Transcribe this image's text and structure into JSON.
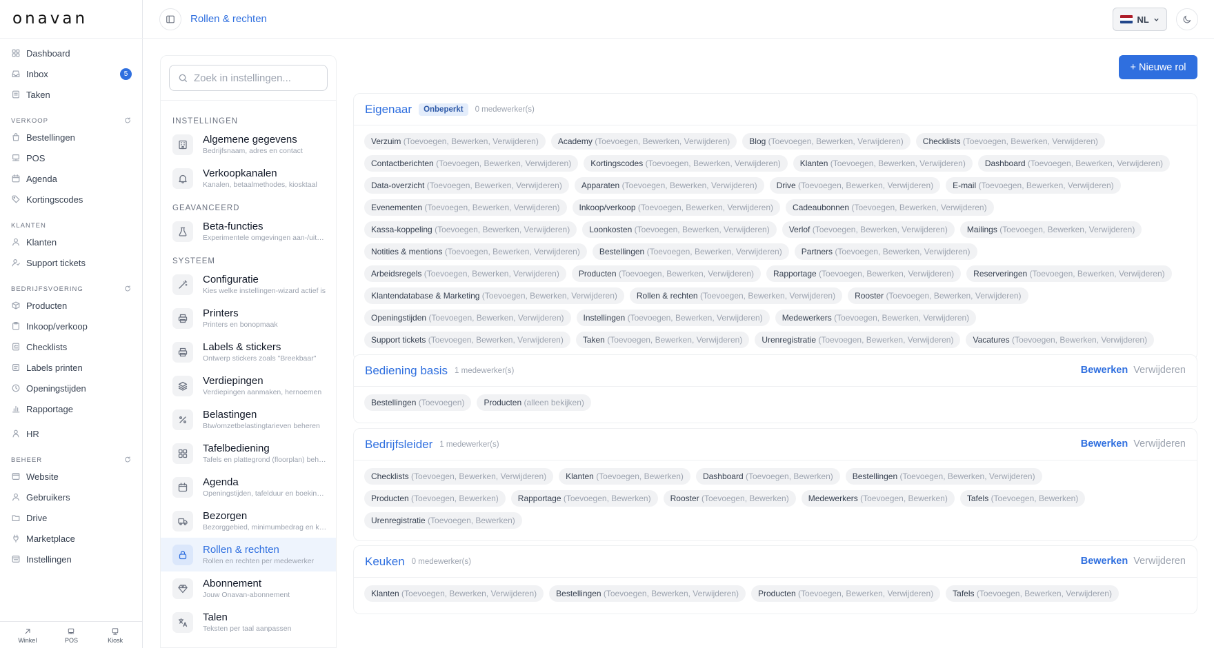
{
  "brand": {
    "logo": "onavan"
  },
  "sidebar": {
    "items_top": [
      {
        "label": "Dashboard",
        "icon": "grid-icon"
      },
      {
        "label": "Inbox",
        "icon": "inbox-icon",
        "badge": "5"
      },
      {
        "label": "Taken",
        "icon": "task-icon"
      }
    ],
    "sections": [
      {
        "title": "VERKOOP",
        "items": [
          {
            "label": "Bestellingen",
            "icon": "shopping-bag-icon"
          },
          {
            "label": "POS",
            "icon": "pos-icon"
          },
          {
            "label": "Agenda",
            "icon": "calendar-icon"
          },
          {
            "label": "Kortingscodes",
            "icon": "tag-icon"
          }
        ]
      },
      {
        "title": "KLANTEN",
        "items": [
          {
            "label": "Klanten",
            "icon": "user-icon"
          },
          {
            "label": "Support tickets",
            "icon": "support-icon"
          }
        ]
      },
      {
        "title": "BEDRIJFSVOERING",
        "items": [
          {
            "label": "Producten",
            "icon": "box-icon"
          },
          {
            "label": "Inkoop/verkoop",
            "icon": "clipboard-icon"
          },
          {
            "label": "Checklists",
            "icon": "checklist-icon"
          },
          {
            "label": "Labels printen",
            "icon": "label-icon"
          },
          {
            "label": "Openingstijden",
            "icon": "clock-icon"
          },
          {
            "label": "Rapportage",
            "icon": "bar-chart-icon"
          }
        ]
      }
    ],
    "hr": {
      "label": "HR",
      "icon": "person-icon"
    },
    "beheer": {
      "title": "BEHEER",
      "items": [
        {
          "label": "Website",
          "icon": "window-icon"
        },
        {
          "label": "Gebruikers",
          "icon": "user-icon"
        },
        {
          "label": "Drive",
          "icon": "folder-icon"
        },
        {
          "label": "Marketplace",
          "icon": "plug-icon"
        },
        {
          "label": "Instellingen",
          "icon": "settings-window-icon"
        }
      ]
    },
    "bottom": [
      {
        "label": "Winkel",
        "icon": "arrow-icon"
      },
      {
        "label": "POS",
        "icon": "pos-icon"
      },
      {
        "label": "Kiosk",
        "icon": "kiosk-icon"
      }
    ]
  },
  "topbar": {
    "title": "Rollen & rechten",
    "language": "NL"
  },
  "settings": {
    "search_placeholder": "Zoek in instellingen...",
    "sections": [
      {
        "title": "INSTELLINGEN",
        "items": [
          {
            "title": "Algemene gegevens",
            "subtitle": "Bedrijfsnaam, adres en contact",
            "icon": "building-icon"
          },
          {
            "title": "Verkoopkanalen",
            "subtitle": "Kanalen, betaalmethodes, kiosktaal",
            "icon": "bell-icon"
          }
        ]
      },
      {
        "title": "GEAVANCEERD",
        "items": [
          {
            "title": "Beta-functies",
            "subtitle": "Experimentele omgevingen aan-/uitzetten",
            "icon": "flask-icon"
          }
        ]
      },
      {
        "title": "SYSTEEM",
        "items": [
          {
            "title": "Configuratie",
            "subtitle": "Kies welke instellingen-wizard actief is",
            "icon": "wand-icon"
          },
          {
            "title": "Printers",
            "subtitle": "Printers en bonopmaak",
            "icon": "printer-icon"
          },
          {
            "title": "Labels & stickers",
            "subtitle": "Ontwerp stickers zoals \"Breekbaar\"",
            "icon": "printer-icon"
          },
          {
            "title": "Verdiepingen",
            "subtitle": "Verdiepingen aanmaken, hernoemen",
            "icon": "layers-icon"
          },
          {
            "title": "Belastingen",
            "subtitle": "Btw/omzetbelastingtarieven beheren",
            "icon": "percent-icon"
          },
          {
            "title": "Tafelbediening",
            "subtitle": "Tafels en plattegrond (floorplan) beheren",
            "icon": "grid-icon"
          },
          {
            "title": "Agenda",
            "subtitle": "Openingstijden, tafelduur en boekingen",
            "icon": "calendar-icon"
          },
          {
            "title": "Bezorgen",
            "subtitle": "Bezorggebied, minimumbedrag en kosten",
            "icon": "truck-icon"
          },
          {
            "title": "Rollen & rechten",
            "subtitle": "Rollen en rechten per medewerker",
            "icon": "lock-icon",
            "active": true
          },
          {
            "title": "Abonnement",
            "subtitle": "Jouw Onavan-abonnement",
            "icon": "diamond-icon"
          },
          {
            "title": "Talen",
            "subtitle": "Teksten per taal aanpassen",
            "icon": "translate-icon"
          }
        ]
      }
    ]
  },
  "main": {
    "new_role_label": "+ Nieuwe rol",
    "edit_label": "Bewerken",
    "delete_label": "Verwijderen",
    "roles": [
      {
        "name": "Eigenaar",
        "badge": "Onbeperkt",
        "count": "0 medewerker(s)",
        "actions": false,
        "permissions": [
          [
            "Verzuim",
            "(Toevoegen, Bewerken, Verwijderen)"
          ],
          [
            "Academy",
            "(Toevoegen, Bewerken, Verwijderen)"
          ],
          [
            "Blog",
            "(Toevoegen, Bewerken, Verwijderen)"
          ],
          [
            "Checklists",
            "(Toevoegen, Bewerken, Verwijderen)"
          ],
          [
            "Contactberichten",
            "(Toevoegen, Bewerken, Verwijderen)"
          ],
          [
            "Kortingscodes",
            "(Toevoegen, Bewerken, Verwijderen)"
          ],
          [
            "Klanten",
            "(Toevoegen, Bewerken, Verwijderen)"
          ],
          [
            "Dashboard",
            "(Toevoegen, Bewerken, Verwijderen)"
          ],
          [
            "Data-overzicht",
            "(Toevoegen, Bewerken, Verwijderen)"
          ],
          [
            "Apparaten",
            "(Toevoegen, Bewerken, Verwijderen)"
          ],
          [
            "Drive",
            "(Toevoegen, Bewerken, Verwijderen)"
          ],
          [
            "E-mail",
            "(Toevoegen, Bewerken, Verwijderen)"
          ],
          [
            "Evenementen",
            "(Toevoegen, Bewerken, Verwijderen)"
          ],
          [
            "Inkoop/verkoop",
            "(Toevoegen, Bewerken, Verwijderen)"
          ],
          [
            "Cadeaubonnen",
            "(Toevoegen, Bewerken, Verwijderen)"
          ],
          [
            "Kassa-koppeling",
            "(Toevoegen, Bewerken, Verwijderen)"
          ],
          [
            "Loonkosten",
            "(Toevoegen, Bewerken, Verwijderen)"
          ],
          [
            "Verlof",
            "(Toevoegen, Bewerken, Verwijderen)"
          ],
          [
            "Mailings",
            "(Toevoegen, Bewerken, Verwijderen)"
          ],
          [
            "Notities & mentions",
            "(Toevoegen, Bewerken, Verwijderen)"
          ],
          [
            "Bestellingen",
            "(Toevoegen, Bewerken, Verwijderen)"
          ],
          [
            "Partners",
            "(Toevoegen, Bewerken, Verwijderen)"
          ],
          [
            "Arbeidsregels",
            "(Toevoegen, Bewerken, Verwijderen)"
          ],
          [
            "Producten",
            "(Toevoegen, Bewerken, Verwijderen)"
          ],
          [
            "Rapportage",
            "(Toevoegen, Bewerken, Verwijderen)"
          ],
          [
            "Reserveringen",
            "(Toevoegen, Bewerken, Verwijderen)"
          ],
          [
            "Klantendatabase & Marketing",
            "(Toevoegen, Bewerken, Verwijderen)"
          ],
          [
            "Rollen & rechten",
            "(Toevoegen, Bewerken, Verwijderen)"
          ],
          [
            "Rooster",
            "(Toevoegen, Bewerken, Verwijderen)"
          ],
          [
            "Openingstijden",
            "(Toevoegen, Bewerken, Verwijderen)"
          ],
          [
            "Instellingen",
            "(Toevoegen, Bewerken, Verwijderen)"
          ],
          [
            "Medewerkers",
            "(Toevoegen, Bewerken, Verwijderen)"
          ],
          [
            "Support tickets",
            "(Toevoegen, Bewerken, Verwijderen)"
          ],
          [
            "Taken",
            "(Toevoegen, Bewerken, Verwijderen)"
          ],
          [
            "Urenregistratie",
            "(Toevoegen, Bewerken, Verwijderen)"
          ],
          [
            "Vacatures",
            "(Toevoegen, Bewerken, Verwijderen)"
          ]
        ]
      },
      {
        "name": "Bediening basis",
        "badge": "",
        "count": "1 medewerker(s)",
        "actions": true,
        "permissions": [
          [
            "Bestellingen",
            "(Toevoegen)"
          ],
          [
            "Producten",
            "(alleen bekijken)"
          ]
        ]
      },
      {
        "name": "Bedrijfsleider",
        "badge": "",
        "count": "1 medewerker(s)",
        "actions": true,
        "permissions": [
          [
            "Checklists",
            "(Toevoegen, Bewerken, Verwijderen)"
          ],
          [
            "Klanten",
            "(Toevoegen, Bewerken)"
          ],
          [
            "Dashboard",
            "(Toevoegen, Bewerken)"
          ],
          [
            "Bestellingen",
            "(Toevoegen, Bewerken, Verwijderen)"
          ],
          [
            "Producten",
            "(Toevoegen, Bewerken)"
          ],
          [
            "Rapportage",
            "(Toevoegen, Bewerken)"
          ],
          [
            "Rooster",
            "(Toevoegen, Bewerken)"
          ],
          [
            "Medewerkers",
            "(Toevoegen, Bewerken)"
          ],
          [
            "Tafels",
            "(Toevoegen, Bewerken)"
          ],
          [
            "Urenregistratie",
            "(Toevoegen, Bewerken)"
          ]
        ]
      },
      {
        "name": "Keuken",
        "badge": "",
        "count": "0 medewerker(s)",
        "actions": true,
        "permissions": [
          [
            "Klanten",
            "(Toevoegen, Bewerken, Verwijderen)"
          ],
          [
            "Bestellingen",
            "(Toevoegen, Bewerken, Verwijderen)"
          ],
          [
            "Producten",
            "(Toevoegen, Bewerken, Verwijderen)"
          ],
          [
            "Tafels",
            "(Toevoegen, Bewerken, Verwijderen)"
          ]
        ]
      }
    ]
  },
  "colors": {
    "accent": "#2f6fdf",
    "chip_bg": "#f1f2f4",
    "muted": "#9ca3af"
  }
}
